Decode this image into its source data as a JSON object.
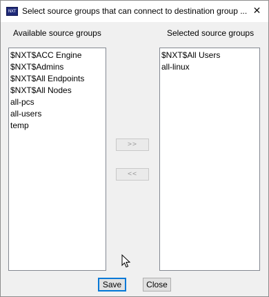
{
  "window": {
    "title": "Select source groups that can connect to destination group ...",
    "icon_text": "NXT",
    "close_glyph": "✕"
  },
  "available": {
    "heading": "Available source groups",
    "items": [
      "$NXT$ACC Engine",
      "$NXT$Admins",
      "$NXT$All Endpoints",
      "$NXT$All Nodes",
      "all-pcs",
      "all-users",
      "temp"
    ]
  },
  "selected": {
    "heading": "Selected source groups",
    "items": [
      "$NXT$All Users",
      "all-linux"
    ]
  },
  "transfer": {
    "add_label": ">>",
    "remove_label": "<<"
  },
  "footer": {
    "save_label": "Save",
    "close_label": "Close"
  }
}
